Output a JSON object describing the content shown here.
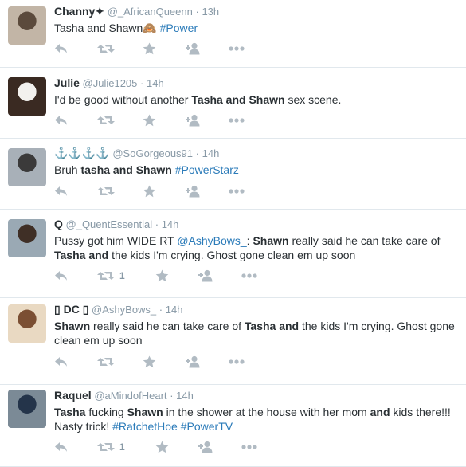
{
  "tweets": [
    {
      "name": "Channy",
      "name_suffix": "✦",
      "handle": "@_AfricanQueenn",
      "sep": "·",
      "time": "13h",
      "segments": [
        {
          "t": "Tasha and Shawn",
          "k": "plain"
        },
        {
          "t": "🙈 ",
          "k": "plain"
        },
        {
          "t": "#Power",
          "k": "tag"
        }
      ],
      "retweets": "",
      "avatar_colors": [
        "#5b4a3c",
        "#c2b5a6"
      ]
    },
    {
      "name": "Julie",
      "name_suffix": "",
      "handle": "@Julie1205",
      "sep": "·",
      "time": "14h",
      "segments": [
        {
          "t": "I'd be good without another ",
          "k": "plain"
        },
        {
          "t": "Tasha and Shawn",
          "k": "bold"
        },
        {
          "t": " sex scene.",
          "k": "plain"
        }
      ],
      "retweets": "",
      "avatar_colors": [
        "#f3f1ee",
        "#3a2a22"
      ]
    },
    {
      "name": "⚓⚓⚓⚓",
      "name_suffix": "",
      "handle": "@SoGorgeous91",
      "sep": "·",
      "time": "14h",
      "segments": [
        {
          "t": "Bruh ",
          "k": "plain"
        },
        {
          "t": "tasha and Shawn",
          "k": "bold"
        },
        {
          "t": " ",
          "k": "plain"
        },
        {
          "t": "#PowerStarz",
          "k": "tag"
        }
      ],
      "retweets": "",
      "avatar_colors": [
        "#3b3a3a",
        "#a8b0b8"
      ]
    },
    {
      "name": "Q",
      "name_suffix": "",
      "handle": "@_QuentEssential",
      "sep": "·",
      "time": "14h",
      "segments": [
        {
          "t": "Pussy got him WIDE RT ",
          "k": "plain"
        },
        {
          "t": "@AshyBows_",
          "k": "mention"
        },
        {
          "t": ": ",
          "k": "plain"
        },
        {
          "t": "Shawn",
          "k": "bold"
        },
        {
          "t": " really said he can take care of ",
          "k": "plain"
        },
        {
          "t": "Tasha and",
          "k": "bold"
        },
        {
          "t": " the kids I'm crying. Ghost gone clean em up soon",
          "k": "plain"
        }
      ],
      "retweets": "1",
      "avatar_colors": [
        "#3f2f26",
        "#9aa9b4"
      ]
    },
    {
      "name": "DC",
      "name_prefix": "▯",
      "name_suffix": "▯",
      "handle": "@AshyBows_",
      "sep": "·",
      "time": "14h",
      "segments": [
        {
          "t": "Shawn",
          "k": "bold"
        },
        {
          "t": " really said he can take care of ",
          "k": "plain"
        },
        {
          "t": "Tasha and",
          "k": "bold"
        },
        {
          "t": " the kids I'm crying. Ghost gone clean em up soon",
          "k": "plain"
        }
      ],
      "retweets": "",
      "avatar_colors": [
        "#7b4f33",
        "#e9d9c2"
      ]
    },
    {
      "name": "Raquel",
      "name_suffix": "",
      "handle": "@aMindofHeart",
      "sep": "·",
      "time": "14h",
      "segments": [
        {
          "t": "Tasha",
          "k": "bold"
        },
        {
          "t": " fucking ",
          "k": "plain"
        },
        {
          "t": "Shawn",
          "k": "bold"
        },
        {
          "t": " in the shower at the house with her mom ",
          "k": "plain"
        },
        {
          "t": "and",
          "k": "bold"
        },
        {
          "t": " kids there!!! Nasty trick! ",
          "k": "plain"
        },
        {
          "t": "#RatchetHoe",
          "k": "tag"
        },
        {
          "t": " ",
          "k": "plain"
        },
        {
          "t": "#PowerTV",
          "k": "tag"
        }
      ],
      "retweets": "1",
      "avatar_colors": [
        "#24344a",
        "#7b8a96"
      ]
    }
  ],
  "icons": {
    "reply": "reply-icon",
    "retweet": "retweet-icon",
    "favorite": "star-icon",
    "follow": "follow-icon",
    "more": "more-icon"
  },
  "colors": {
    "link": "#2b7bb9",
    "muted": "#8899a6",
    "icon": "#b1bbc3",
    "text": "#292f33",
    "divider": "#e1e8ed"
  }
}
